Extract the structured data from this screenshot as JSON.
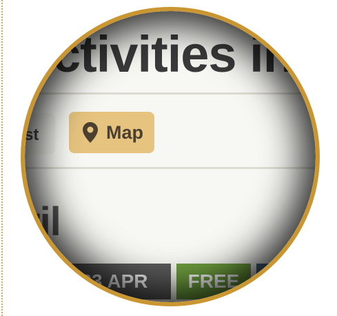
{
  "header": {
    "title_visible": "ctivities in"
  },
  "view_tabs": {
    "list_label": "st",
    "map_label": "Map"
  },
  "section": {
    "heading_visible": "ril"
  },
  "badges": {
    "date_label": "23 APR",
    "free_label": "FREE"
  },
  "icons": {
    "map": "map-pin-icon",
    "filter": "filter-icon"
  },
  "colors": {
    "lens_border": "#c99631",
    "map_tab_bg": "#e6c47f",
    "date_badge_bg": "#5b5b5b",
    "free_badge_bg": "#6e9e3f",
    "filter_badge_bg": "#4d6b87"
  }
}
